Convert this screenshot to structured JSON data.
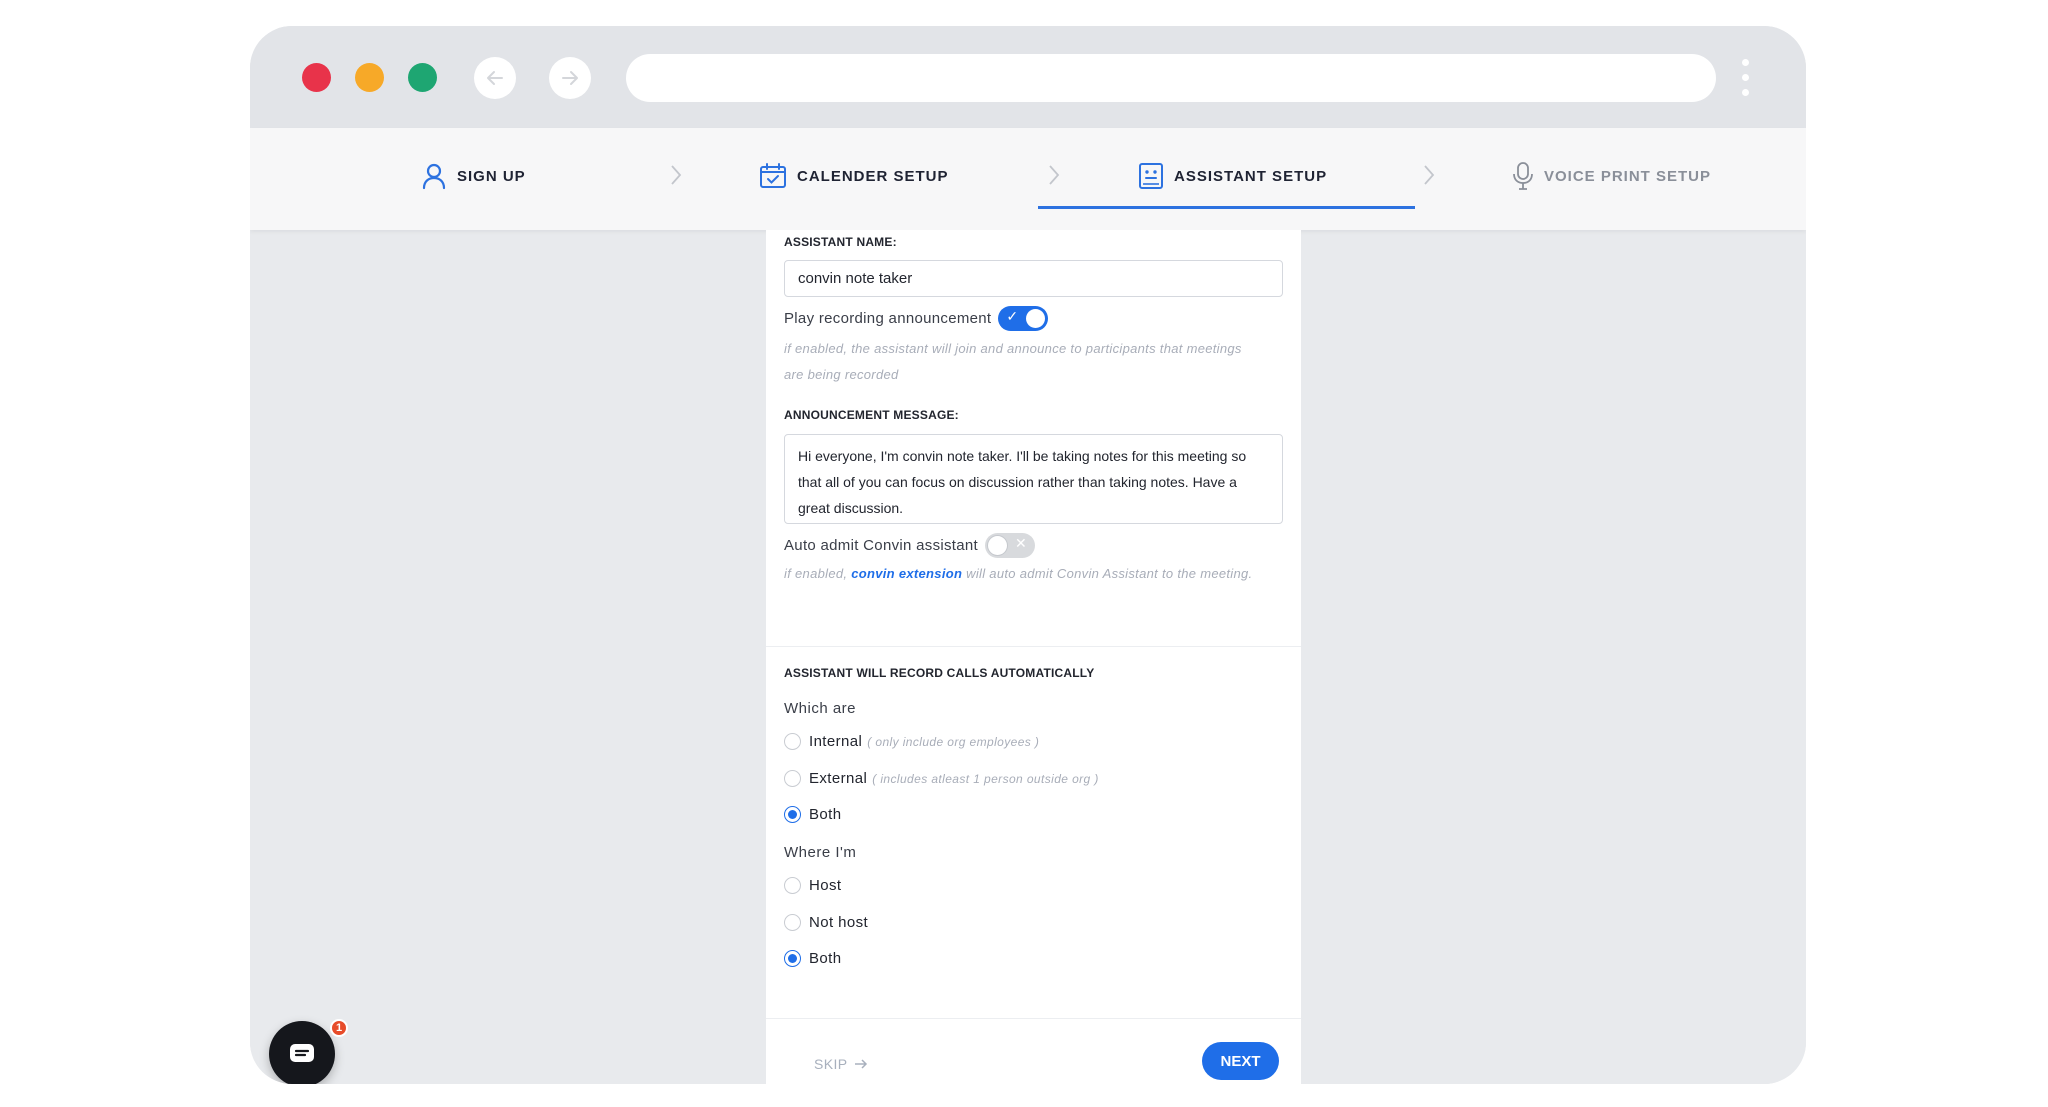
{
  "colors": {
    "accent": "#1f6ee8",
    "traffic_red": "#e8334a",
    "traffic_yellow": "#f7a928",
    "traffic_green": "#1ea672"
  },
  "browser": {
    "icons": [
      "arrow-left-icon",
      "arrow-right-icon",
      "kebab-menu-icon"
    ],
    "url": ""
  },
  "steps": [
    {
      "label": "SIGN UP",
      "icon": "user-icon",
      "active": false
    },
    {
      "label": "CALENDER SETUP",
      "icon": "calendar-icon",
      "active": false
    },
    {
      "label": "ASSISTANT SETUP",
      "icon": "assistant-icon",
      "active": true
    },
    {
      "label": "VOICE PRINT SETUP",
      "icon": "microphone-icon",
      "active": false
    }
  ],
  "form": {
    "assistant_name_label": "ASSISTANT NAME:",
    "assistant_name_value": "convin note taker",
    "play_recording_label": "Play recording announcement",
    "play_recording_on": true,
    "play_recording_hint": "if enabled, the assistant will join and announce to participants that meetings are being recorded",
    "announcement_label": "ANNOUNCEMENT MESSAGE:",
    "announcement_value": "Hi everyone, I'm convin note taker. I'll be taking notes for this meeting so that all of you can focus on discussion rather than taking notes. Have a great discussion.",
    "auto_admit_label": "Auto admit Convin assistant",
    "auto_admit_on": false,
    "auto_admit_hint_prefix": "if enabled,",
    "auto_admit_hint_link": "convin extension",
    "auto_admit_hint_suffix": "will auto admit Convin Assistant to the meeting."
  },
  "record": {
    "heading": "ASSISTANT WILL RECORD CALLS AUTOMATICALLY",
    "which_label": "Which are",
    "which_options": [
      {
        "label": "Internal",
        "note": "( only include org employees )",
        "checked": false
      },
      {
        "label": "External",
        "note": "( includes atleast 1 person outside org )",
        "checked": false
      },
      {
        "label": "Both",
        "note": "",
        "checked": true
      }
    ],
    "where_label": "Where I'm",
    "where_options": [
      {
        "label": "Host",
        "checked": false
      },
      {
        "label": "Not host",
        "checked": false
      },
      {
        "label": "Both",
        "checked": true
      }
    ]
  },
  "footer": {
    "skip_label": "SKIP",
    "next_label": "NEXT"
  },
  "chat": {
    "icon": "chat-icon",
    "badge_count": "1"
  }
}
